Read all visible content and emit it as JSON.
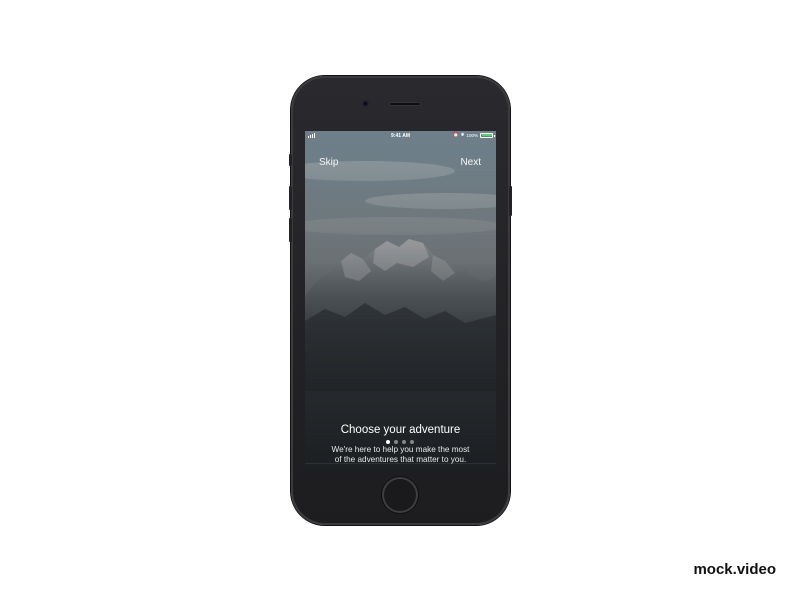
{
  "statusbar": {
    "time": "9:41 AM",
    "battery_text": "100%",
    "battery_color": "#4cd964"
  },
  "onboarding": {
    "skip_label": "Skip",
    "next_label": "Next",
    "title": "Choose your adventure",
    "subtitle_line1": "We're here to help you make the most",
    "subtitle_line2": "of the adventures that matter to you.",
    "page_count": 4,
    "active_page": 1
  },
  "watermark": "mock.video",
  "colors": {
    "phone_body": "#1f1f22",
    "sky_top": "#7d8d96",
    "sky_bottom": "#b8c2c6",
    "mountain_snow": "#dfe3e6",
    "ground_dark": "#2b2f33"
  }
}
